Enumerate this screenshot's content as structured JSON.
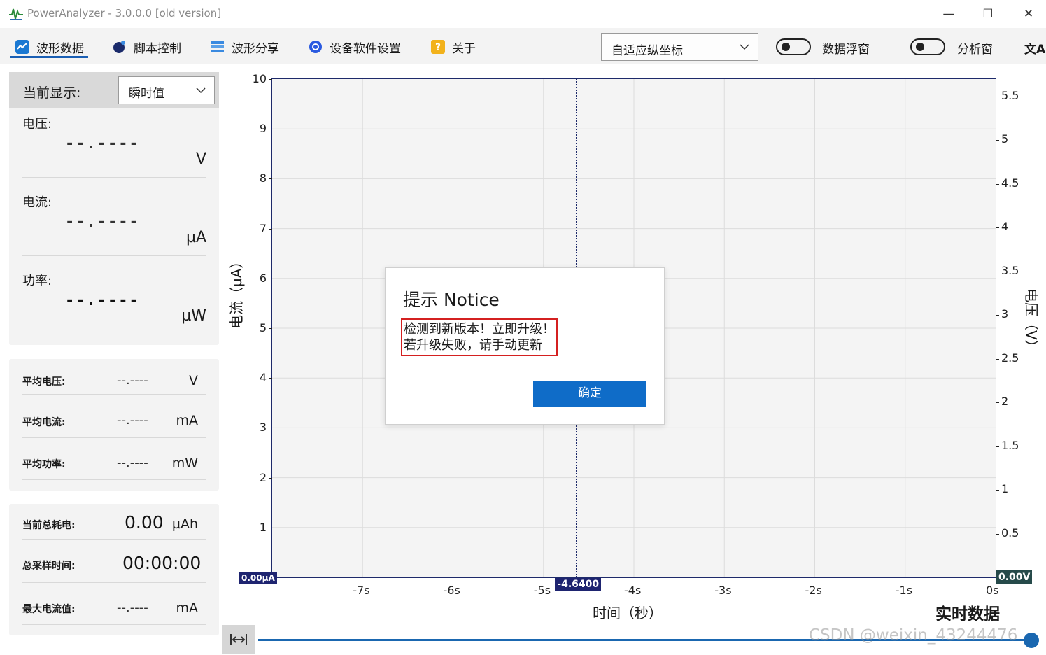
{
  "window": {
    "title": "PowerAnalyzer - 3.0.0.0  [old version]",
    "minimize_glyph": "—",
    "maximize_glyph": "☐",
    "close_glyph": "✕"
  },
  "toolbar": {
    "tabs": [
      {
        "label": "波形数据",
        "icon": "waveform-icon",
        "active": true
      },
      {
        "label": "脚本控制",
        "icon": "script-icon"
      },
      {
        "label": "波形分享",
        "icon": "share-icon"
      },
      {
        "label": "设备软件设置",
        "icon": "settings-icon"
      },
      {
        "label": "关于",
        "icon": "about-icon"
      }
    ],
    "axis_mode": "自适应纵坐标",
    "float_toggle_label": "数据浮窗",
    "analysis_toggle_label": "分析窗",
    "translate_glyph": "文A"
  },
  "left_panel": {
    "display_label": "当前显示:",
    "display_value": "瞬时值",
    "voltage": {
      "label": "电压:",
      "value": "--.----",
      "unit": "V"
    },
    "current": {
      "label": "电流:",
      "value": "--.----",
      "unit": "µA"
    },
    "power": {
      "label": "功率:",
      "value": "--.----",
      "unit": "µW"
    },
    "averages": [
      {
        "label": "平均电压:",
        "value": "--.----",
        "unit": "V"
      },
      {
        "label": "平均电流:",
        "value": "--.----",
        "unit": "mA"
      },
      {
        "label": "平均功率:",
        "value": "--.----",
        "unit": "mW"
      }
    ],
    "totals": [
      {
        "label": "当前总耗电:",
        "value": "0.00",
        "unit": "µAh"
      },
      {
        "label": "总采样时间:",
        "value": "00:00:00",
        "unit": ""
      },
      {
        "label": "最大电流值:",
        "value": "--.----",
        "unit": "mA"
      }
    ]
  },
  "chart_data": {
    "type": "line",
    "title": "实时数据",
    "xlabel": "时间（秒）",
    "ylabel": "电流（µA）",
    "y2label": "电压（V）",
    "x_ticks": [
      "-7s",
      "-6s",
      "-5s",
      "-4s",
      "-3s",
      "-2s",
      "-1s",
      "0s"
    ],
    "y_ticks": [
      "10",
      "9",
      "8",
      "7",
      "6",
      "5",
      "4",
      "3",
      "2",
      "1"
    ],
    "y2_ticks": [
      "5.5",
      "5",
      "4.5",
      "4",
      "3.5",
      "3",
      "2.5",
      "2",
      "1.5",
      "1",
      "0.5"
    ],
    "ylim": [
      0,
      10
    ],
    "y2lim": [
      0,
      5.7
    ],
    "xlim": [
      -8,
      0
    ],
    "grid": true,
    "series": [],
    "cursor_x": -4.64,
    "cursor_label": "-4.6400",
    "left_readout": "0.00µA",
    "right_readout": "0.00V"
  },
  "dialog": {
    "title": "提示 Notice",
    "message_line1": "检测到新版本！立即升级！",
    "message_line2": "若升级失败，请手动更新",
    "ok_label": "确定"
  },
  "watermark": "CSDN @weixin_43244476"
}
